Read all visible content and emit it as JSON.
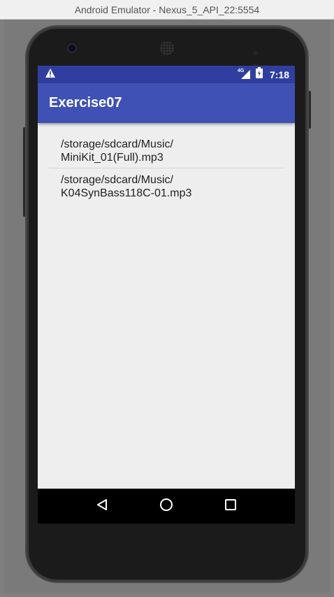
{
  "window": {
    "title": "Android Emulator - Nexus_5_API_22:5554"
  },
  "statusbar": {
    "time": "7:18",
    "network_label": "4G",
    "icons": [
      "warning-icon",
      "signal-icon",
      "battery-icon"
    ],
    "color": "#303f9f"
  },
  "appbar": {
    "title": "Exercise07",
    "color": "#3f51b5"
  },
  "list": {
    "items": [
      {
        "line1": "/storage/sdcard/Music/",
        "line2": "MiniKit_01(Full).mp3"
      },
      {
        "line1": "/storage/sdcard/Music/",
        "line2": "K04SynBass118C-01.mp3"
      }
    ]
  },
  "navbar": {
    "buttons": [
      "back-icon",
      "home-icon",
      "recents-icon"
    ]
  }
}
